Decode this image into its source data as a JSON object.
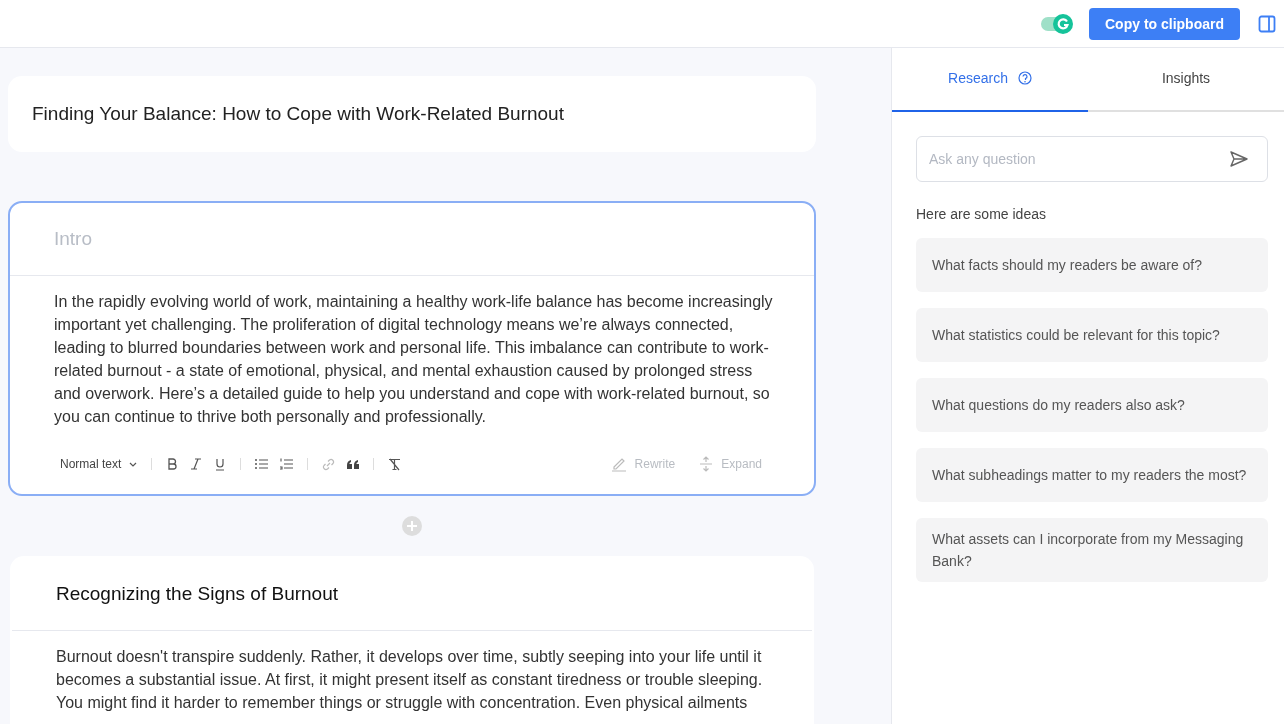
{
  "topbar": {
    "toggle": {
      "on": true
    },
    "copy_button": "Copy to clipboard"
  },
  "document": {
    "title": "Finding Your Balance: How to Cope with Work-Related Burnout",
    "sections": [
      {
        "heading": "Intro",
        "heading_placeholder": true,
        "focused": true,
        "body": "In the rapidly evolving world of work, maintaining a healthy work-life balance has become increasingly important yet challenging. The proliferation of digital technology means we’re always connected, leading to blurred boundaries between work and personal life. This imbalance can contribute to work-related burnout - a state of emotional, physical, and mental exhaustion caused by prolonged stress and overwork. Here’s a detailed guide to help you understand and cope with work-related burnout, so you can continue to thrive both personally and professionally.",
        "toolbar": {
          "style": "Normal text",
          "actions": [
            "Rewrite",
            "Expand"
          ]
        }
      },
      {
        "heading": "Recognizing the Signs of Burnout",
        "heading_placeholder": false,
        "focused": false,
        "body": "Burnout doesn't transpire suddenly. Rather, it develops over time, subtly seeping into your life until it becomes a substantial issue. At first, it might present itself as constant tiredness or trouble sleeping. You might find it harder to remember things or struggle with concentration. Even physical ailments"
      }
    ]
  },
  "panel": {
    "tabs": [
      {
        "label": "Research",
        "selected": true
      },
      {
        "label": "Insights",
        "selected": false
      }
    ],
    "search": {
      "placeholder": "Ask any question"
    },
    "ideas_label": "Here are some ideas",
    "ideas": [
      "What facts should my readers be aware of?",
      "What statistics could be relevant for this topic?",
      "What questions do my readers also ask?",
      "What subheadings matter to my readers the most?",
      "What assets can I incorporate from my Messaging Bank?"
    ]
  }
}
